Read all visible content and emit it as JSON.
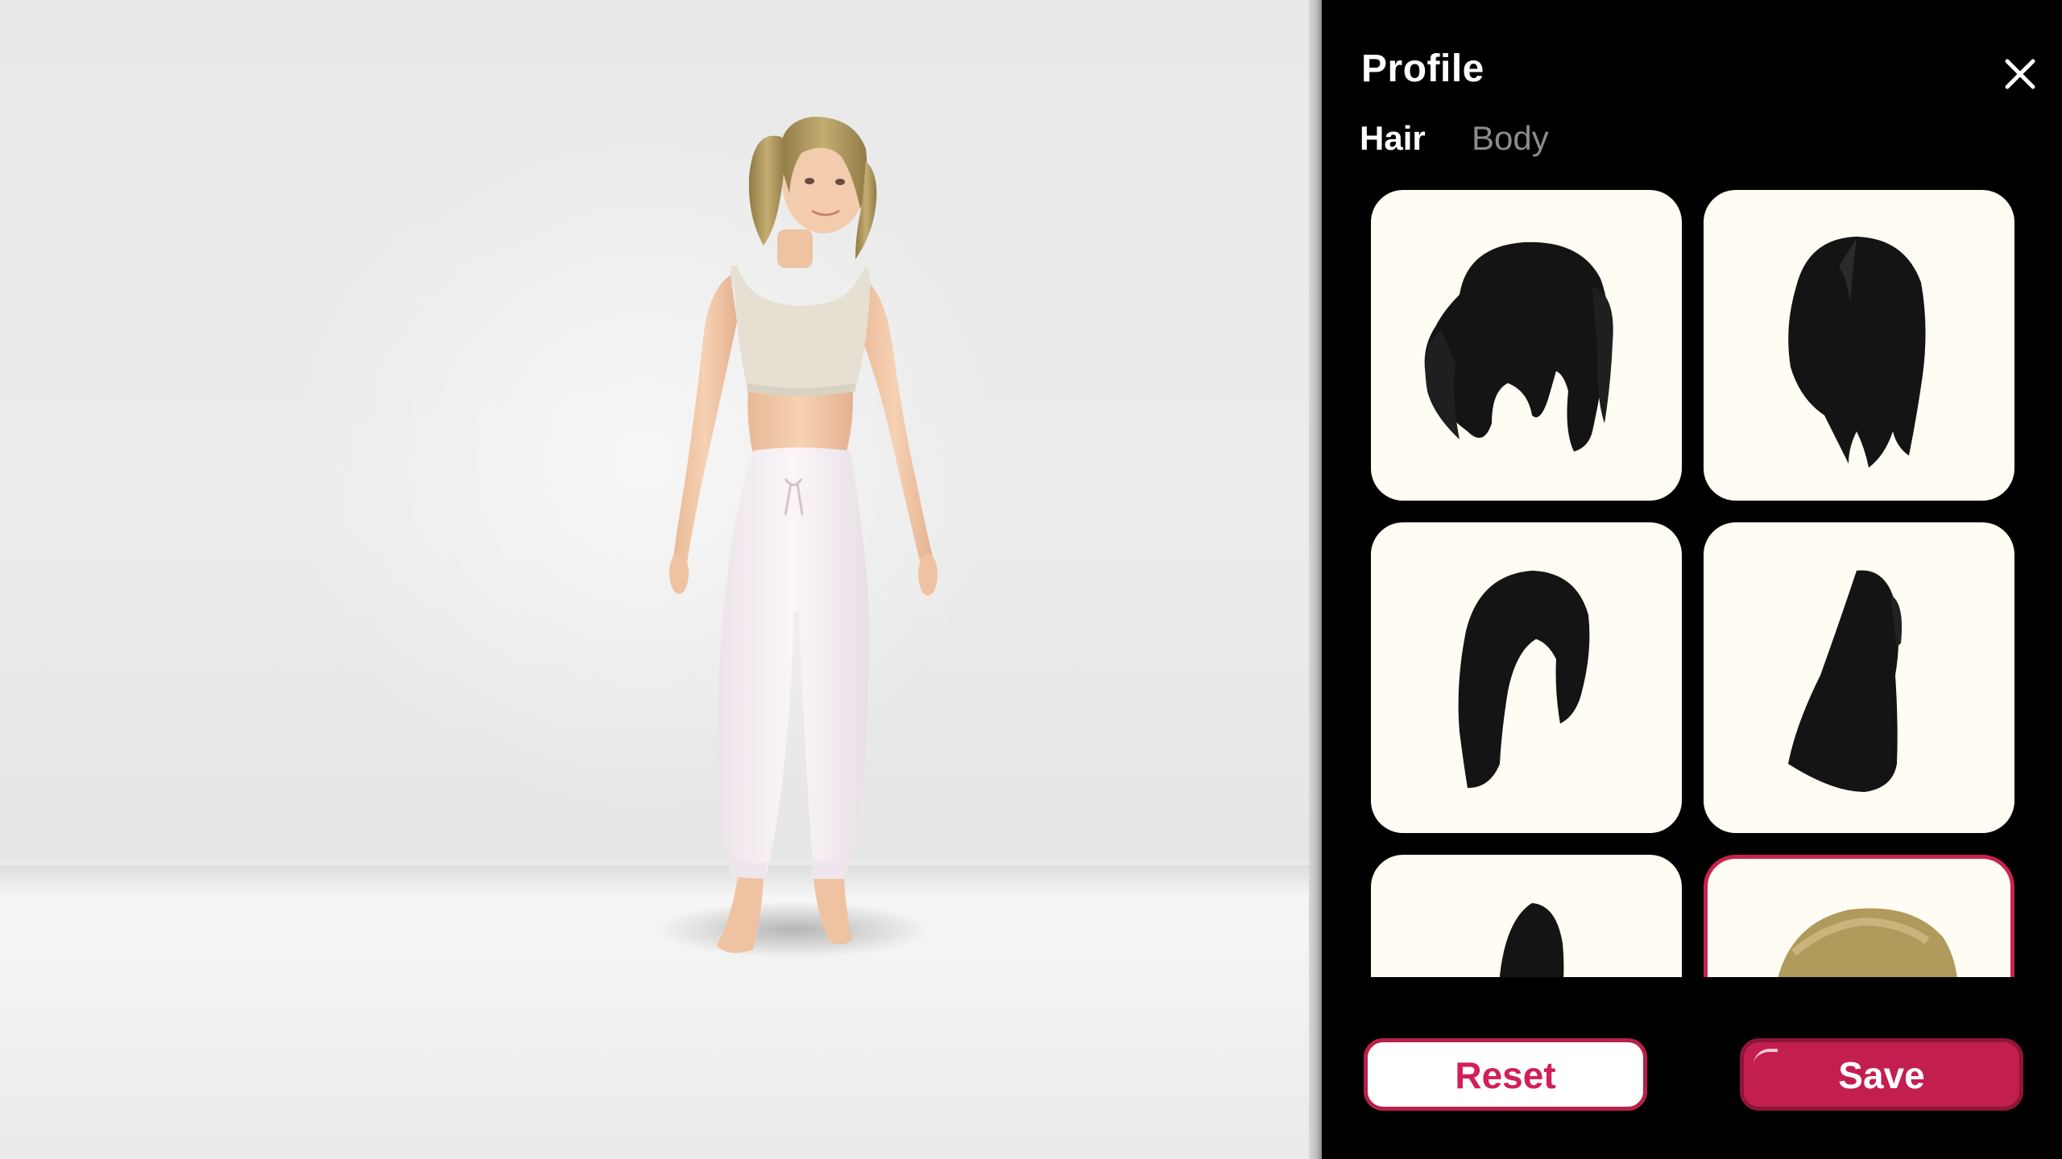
{
  "panel": {
    "title": "Profile",
    "tabs": [
      {
        "label": "Hair",
        "active": true
      },
      {
        "label": "Body",
        "active": false
      }
    ],
    "hair_options": [
      {
        "style": "black-pigtails",
        "color": "#141414",
        "selected": false
      },
      {
        "style": "black-long-center-part",
        "color": "#141414",
        "selected": false
      },
      {
        "style": "black-bob-side-part",
        "color": "#141414",
        "selected": false
      },
      {
        "style": "black-long-straight",
        "color": "#141414",
        "selected": false
      },
      {
        "style": "black-updo",
        "color": "#141414",
        "selected": false
      },
      {
        "style": "blonde-pigtails",
        "color": "#b09a5c",
        "selected": true
      }
    ],
    "actions": {
      "reset_label": "Reset",
      "save_label": "Save"
    },
    "close_icon": "close-icon"
  },
  "colors": {
    "accent": "#c31f4e",
    "panel_bg": "#000000",
    "card_bg": "#fffcf3",
    "tab_inactive": "#8c8c8c"
  }
}
